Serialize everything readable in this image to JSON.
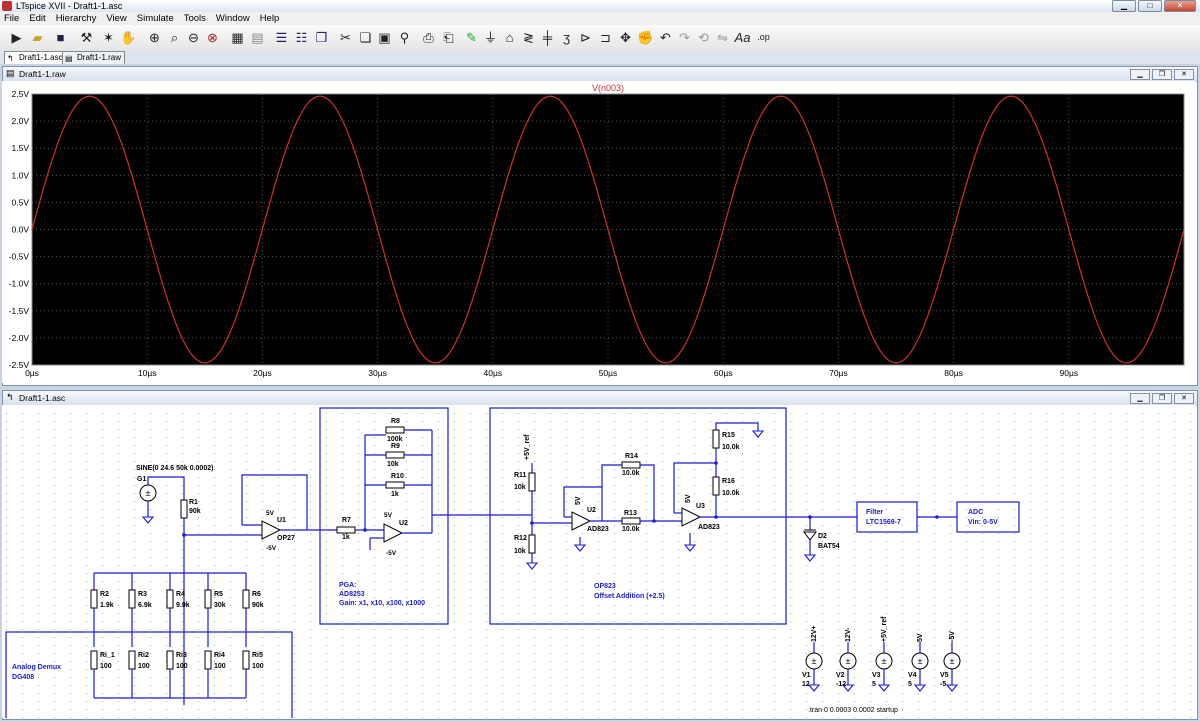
{
  "window": {
    "title": "LTspice XVII - Draft1-1.asc"
  },
  "menu": [
    "File",
    "Edit",
    "Hierarchy",
    "View",
    "Simulate",
    "Tools",
    "Window",
    "Help"
  ],
  "tabs": [
    {
      "label": "Draft1-1.asc"
    },
    {
      "label": "Draft1-1.raw"
    }
  ],
  "waveform_window": {
    "title": "Draft1-1.raw",
    "trace_label": "V(n003)",
    "trace_color": "#c83232",
    "background": "#000000"
  },
  "schematic_window": {
    "title": "Draft1-1.asc"
  },
  "chart_data": {
    "type": "line",
    "title": "V(n003)",
    "xlabel": "",
    "ylabel": "",
    "x_ticks": [
      "0µs",
      "10µs",
      "20µs",
      "30µs",
      "40µs",
      "50µs",
      "60µs",
      "70µs",
      "80µs",
      "90µs"
    ],
    "y_ticks": [
      "2.5V",
      "2.0V",
      "1.5V",
      "1.0V",
      "0.5V",
      "0.0V",
      "-0.5V",
      "-1.0V",
      "-1.5V",
      "-2.0V",
      "-2.5V"
    ],
    "xlim": [
      0,
      100
    ],
    "ylim": [
      -2.5,
      2.5
    ],
    "x_unit": "µs",
    "series": [
      {
        "name": "V(n003)",
        "function": "sine",
        "amplitude": 2.46,
        "frequency_khz": 50,
        "offset": 0,
        "color": "#c83232"
      }
    ],
    "grid": true
  },
  "schematic": {
    "source": {
      "name": "G1",
      "spec": "SINE(0 24.6 50k 0.0002)"
    },
    "r1": {
      "name": "R1",
      "value": "90k"
    },
    "u1": {
      "name": "U1",
      "part": "OP27",
      "vp": "5V",
      "vn": "-5V"
    },
    "r7": {
      "name": "R7",
      "value": "1k"
    },
    "u2pga": {
      "name": "U2",
      "pos": "5V",
      "neg": "-5V"
    },
    "r8": {
      "name": "R8",
      "value": "100k"
    },
    "r9": {
      "name": "R9",
      "value": "10k"
    },
    "r10": {
      "name": "R10",
      "value": "1k"
    },
    "pga_label": [
      "PGA:",
      "AD8253",
      "Gain: x1, x10, x100, x1000"
    ],
    "r11": {
      "name": "R11",
      "value": "10k"
    },
    "r12": {
      "name": "R12",
      "value": "10k"
    },
    "r13": {
      "name": "R13",
      "value": "10.0k"
    },
    "r14": {
      "name": "R14",
      "value": "10.0k"
    },
    "r15": {
      "name": "R15",
      "value": "10.0k"
    },
    "r16": {
      "name": "R16",
      "value": "10.0k"
    },
    "u2": {
      "name": "U2",
      "part": "AD823",
      "supply": "5V"
    },
    "u3": {
      "name": "U3",
      "part": "AD823",
      "supply": "5V"
    },
    "vref_label": "+5V_ref",
    "op_label": [
      "OP823",
      "Offset Addition (+2.5)"
    ],
    "d2": {
      "name": "D2",
      "part": "BAT54"
    },
    "filter": [
      "Filter",
      "LTC1569-7"
    ],
    "adc": [
      "ADC",
      "Vin: 0-5V"
    ],
    "divider": [
      {
        "name": "R2",
        "value": "1.9k"
      },
      {
        "name": "R3",
        "value": "6.9k"
      },
      {
        "name": "R4",
        "value": "9.9k"
      },
      {
        "name": "R5",
        "value": "30k"
      },
      {
        "name": "R6",
        "value": "90k"
      }
    ],
    "demux_res": [
      {
        "name": "Ri_1",
        "value": "100"
      },
      {
        "name": "Ri2",
        "value": "100"
      },
      {
        "name": "Ri3",
        "value": "100"
      },
      {
        "name": "Ri4",
        "value": "100"
      },
      {
        "name": "Ri5",
        "value": "100"
      }
    ],
    "demux_label": [
      "Analog Demux",
      "DG408"
    ],
    "supplies": [
      {
        "net": "12V+",
        "name": "V1",
        "value": "12"
      },
      {
        "net": "12V-",
        "name": "V2",
        "value": "-12"
      },
      {
        "net": "+5V_ref",
        "name": "V3",
        "value": "5"
      },
      {
        "net": "5V",
        "name": "V4",
        "value": "5"
      },
      {
        "net": "-5V",
        "name": "V5",
        "value": "-5"
      }
    ],
    "tran_directive": ".tran 0 0.0003 0.0002 startup"
  }
}
